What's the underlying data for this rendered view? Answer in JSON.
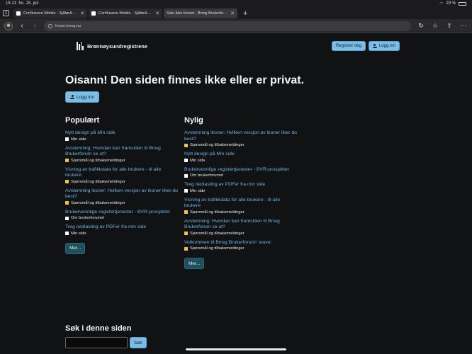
{
  "status_bar": {
    "time": "15:13",
    "date": "fre. 25. juli",
    "battery": "29 %"
  },
  "browser": {
    "tab_count": "3",
    "tabs": [
      {
        "label": "Confluence Mobile - Sjåfør&Settings"
      },
      {
        "label": "Confluence Mobile - Sjåfør&Settings"
      },
      {
        "label": "Side ikke funnet - Brreg Brukerforum"
      }
    ],
    "url": "forum.brreg.no"
  },
  "header": {
    "logo_text": "Brønnøysundregistrene",
    "register_label": "Registrer deg",
    "login_label": "Logg inn"
  },
  "main": {
    "title": "Oisann! Den siden finnes ikke eller er privat.",
    "login_label": "Logg inn"
  },
  "popular": {
    "heading": "Populært",
    "items": [
      {
        "title": "Nytt design på Min side",
        "category": "Min side",
        "color": "#ffffff"
      },
      {
        "title": "Avstemning: Hvordan kan framsiden til Brreg Brukerforum se ut?",
        "category": "Spørsmål og tilbakemeldinger",
        "color": "#f0c24a"
      },
      {
        "title": "Visning av trafikkdata for alle brukere - til alle brukere",
        "category": "Spørsmål og tilbakemeldinger",
        "color": "#f0c24a"
      },
      {
        "title": "Avstemning ikoner: Hvilken versjon av ikoner liker du best?",
        "category": "Spørsmål og tilbakemeldinger",
        "color": "#f0c24a"
      },
      {
        "title": "Brukervennlige registertjenester - BVR-prosjektet",
        "category": "Om brukerforumet",
        "color": "#ffffff"
      },
      {
        "title": "Treg nedlasting av PDFer fra min side",
        "category": "Min side",
        "color": "#ffffff"
      }
    ],
    "more_label": "Mer..."
  },
  "recent": {
    "heading": "Nylig",
    "items": [
      {
        "title": "Avstemning ikoner: Hvilken versjon av ikoner liker du best?",
        "category": "Spørsmål og tilbakemeldinger",
        "color": "#f0c24a"
      },
      {
        "title": "Nytt design på Min side",
        "category": "Min side",
        "color": "#ffffff"
      },
      {
        "title": "Brukervennlige registertjenester - BVR-prosjektet",
        "category": "Om brukerforumet",
        "color": "#ffffff"
      },
      {
        "title": "Treg nedlasting av PDFer fra min side",
        "category": "Min side",
        "color": "#ffffff"
      },
      {
        "title": "Visning av trafikkdata for alle brukere - til alle brukere",
        "category": "Spørsmål og tilbakemeldinger",
        "color": "#f0c24a"
      },
      {
        "title": "Avstemning: Hvordan kan framsiden til Brreg Brukerforum se ut?",
        "category": "Spørsmål og tilbakemeldinger",
        "color": "#f0c24a"
      },
      {
        "title": "Velkommen til Brreg Brukerforum! :wave:",
        "category": "Spørsmål og tilbakemeldinger",
        "color": "#f0c24a"
      }
    ],
    "more_label": "Mer..."
  },
  "search": {
    "heading": "Søk i denne siden",
    "button_label": "Søk",
    "input_value": ""
  }
}
